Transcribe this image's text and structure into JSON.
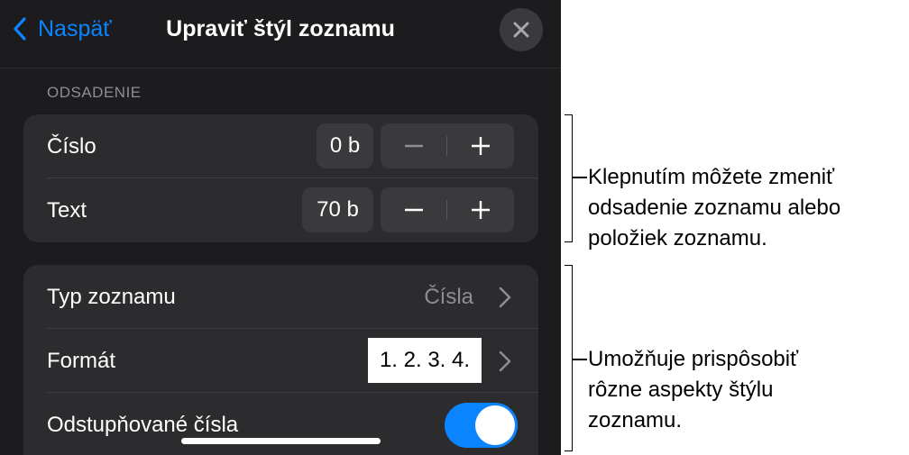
{
  "nav": {
    "back_label": "Naspäť",
    "title": "Upraviť štýl zoznamu",
    "close_icon": "close-icon"
  },
  "section": {
    "label": "ODSADENIE"
  },
  "indent_rows": [
    {
      "label": "Číslo",
      "value": "0 b",
      "minus": "−",
      "plus": "+"
    },
    {
      "label": "Text",
      "value": "70 b",
      "minus": "−",
      "plus": "+"
    }
  ],
  "list_rows": {
    "type": {
      "label": "Typ zoznamu",
      "value": "Čísla"
    },
    "format": {
      "label": "Formát",
      "value": "1. 2. 3. 4."
    },
    "tiered": {
      "label": "Odstupňované čísla",
      "toggle_on": true
    }
  },
  "callouts": {
    "first": [
      "Klepnutím môžete zmeniť",
      "odsadenie zoznamu alebo",
      "položiek zoznamu."
    ],
    "second": [
      "Umožňuje prispôsobiť",
      "rôzne aspekty štýlu",
      "zoznamu."
    ]
  },
  "colors": {
    "accent": "#0a84ff",
    "panel": "#1c1c1e",
    "group": "#2c2c2e"
  }
}
